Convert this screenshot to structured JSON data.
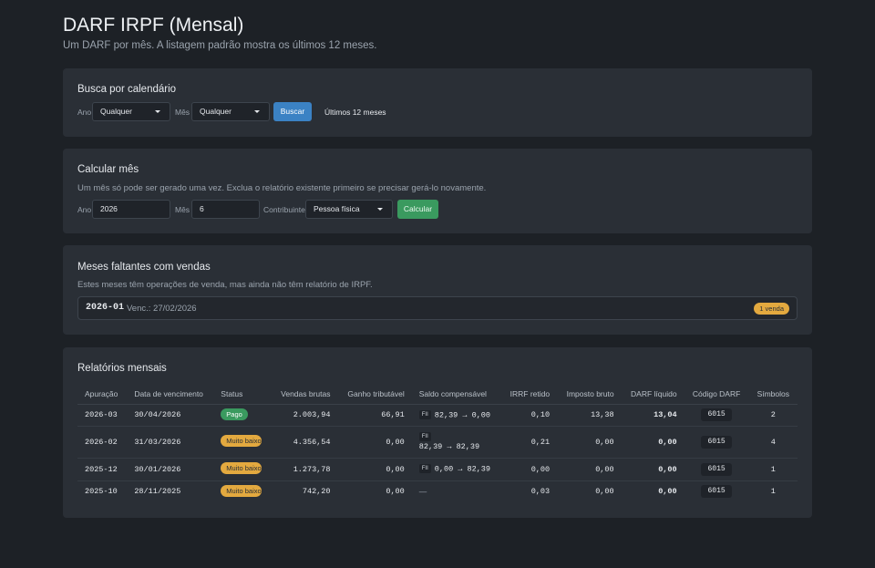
{
  "header": {
    "title": "DARF IRPF (Mensal)",
    "subtitle": "Um DARF por mês. A listagem padrão mostra os últimos 12 meses."
  },
  "search": {
    "title": "Busca por calendário",
    "year_label": "Ano",
    "year_value": "Qualquer",
    "month_label": "Mês",
    "month_value": "Qualquer",
    "button_label": "Buscar",
    "scope_text": "Últimos 12 meses"
  },
  "calculate": {
    "title": "Calcular mês",
    "description": "Um mês só pode ser gerado uma vez. Exclua o relatório existente primeiro se precisar gerá-lo novamente.",
    "year_label": "Ano",
    "year_value": "2026",
    "month_label": "Mês",
    "month_value": "6",
    "taxpayer_label": "Contribuinte",
    "taxpayer_value": "Pessoa física",
    "button_label": "Calcular"
  },
  "missing": {
    "title": "Meses faltantes com vendas",
    "description": "Estes meses têm operações de venda, mas ainda não têm relatório de IRPF.",
    "items": [
      {
        "month": "2026-01",
        "due": "Venc.: 27/02/2026",
        "badge": "1 venda"
      }
    ]
  },
  "reports": {
    "title": "Relatórios mensais",
    "columns": [
      "Apuração",
      "Data de vencimento",
      "Status",
      "Vendas brutas",
      "Ganho tributável",
      "Saldo compensável",
      "IRRF retido",
      "Imposto bruto",
      "DARF líquido",
      "Código DARF",
      "Símbolos"
    ],
    "rows": [
      {
        "period": "2026-03",
        "due": "30/04/2026",
        "status": "Pago",
        "gross": "2.003,94",
        "taxable": "66,91",
        "saldo_tag": "FII",
        "saldo": "82,39 → 0,00",
        "irrf": "0,10",
        "imposto": "13,38",
        "darf": "13,04",
        "code": "6015",
        "symbols": "2"
      },
      {
        "period": "2026-02",
        "due": "31/03/2026",
        "status": "Muito baixo",
        "gross": "4.356,54",
        "taxable": "0,00",
        "saldo_tag": "FII",
        "saldo": "82,39 → 82,39",
        "irrf": "0,21",
        "imposto": "0,00",
        "darf": "0,00",
        "code": "6015",
        "symbols": "4"
      },
      {
        "period": "2025-12",
        "due": "30/01/2026",
        "status": "Muito baixo",
        "gross": "1.273,78",
        "taxable": "0,00",
        "saldo_tag": "FII",
        "saldo": "0,00 → 82,39",
        "irrf": "0,00",
        "imposto": "0,00",
        "darf": "0,00",
        "code": "6015",
        "symbols": "1"
      },
      {
        "period": "2025-10",
        "due": "28/11/2025",
        "status": "Muito baixo",
        "gross": "742,20",
        "taxable": "0,00",
        "saldo_tag": "",
        "saldo": "—",
        "irrf": "0,03",
        "imposto": "0,00",
        "darf": "0,00",
        "code": "6015",
        "symbols": "1"
      }
    ]
  },
  "colors": {
    "background": "#1d2126",
    "card": "#2a2f36",
    "primary_button": "#3b82c4",
    "success_button": "#3a9a5f",
    "warning_badge": "#e3a93f"
  }
}
